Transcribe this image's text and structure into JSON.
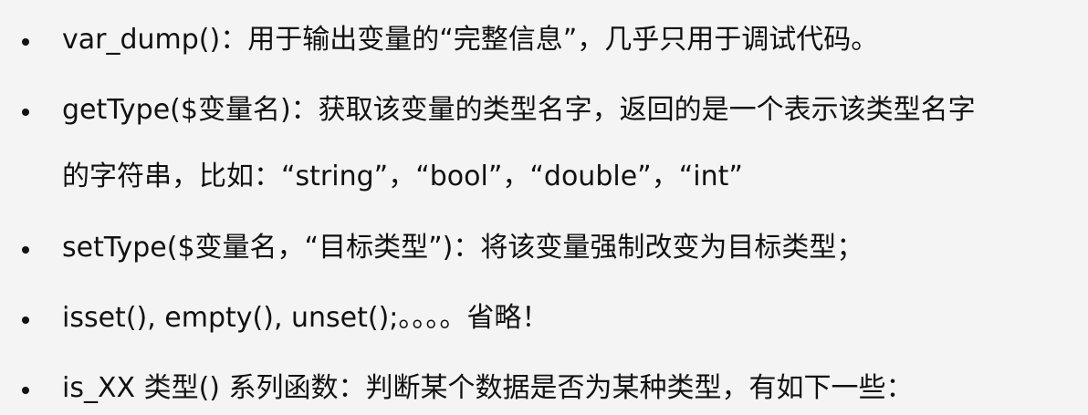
{
  "bullets": [
    {
      "text": "var_dump()：用于输出变量的“完整信息”，几乎只用于调试代码。"
    },
    {
      "text": "getType($变量名)：获取该变量的类型名字，返回的是一个表示该类型名字",
      "continuation": "的字符串，比如：“string”，“bool”，“double”，“int”"
    },
    {
      "text": "setType($变量名，“目标类型”)：将该变量强制改变为目标类型；"
    },
    {
      "text": "isset(), empty(), unset();。。。。省略！"
    },
    {
      "text": "is_XX 类型() 系列函数：判断某个数据是否为某种类型，有如下一些："
    }
  ],
  "colors": {
    "background": "#f4f4f4",
    "text": "#111111"
  }
}
